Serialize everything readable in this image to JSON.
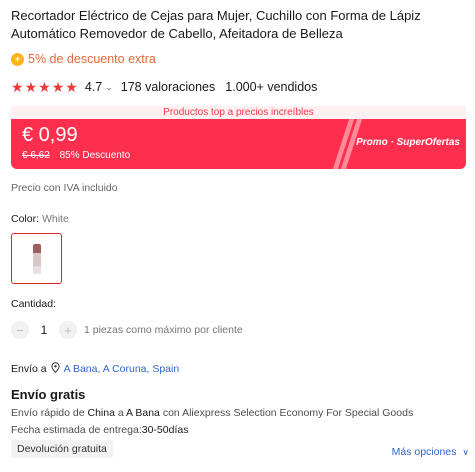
{
  "product": {
    "title": "Recortador Eléctrico de Cejas para Mujer, Cuchillo con Forma de Lápiz Automático Removedor de Cabello, Afeitadora de Belleza",
    "extra_discount": "5% de descuento extra",
    "rating": "4.7",
    "reviews": "178 valoraciones",
    "sold": "1.000+ vendidos"
  },
  "promo": {
    "strip_text": "Productos top a precios increíbles",
    "price": "€ 0,99",
    "original_price": "€ 6,62",
    "discount": "85% Descuento",
    "label": "Promo · SuperOfertas"
  },
  "tax_note": "Precio con IVA incluido",
  "color": {
    "label": "Color:",
    "value": "White"
  },
  "quantity": {
    "label": "Cantidad:",
    "value": "1",
    "minus": "−",
    "plus": "+",
    "note": "1 piezas como máximo por cliente"
  },
  "shipping": {
    "to_label": "Envío a",
    "location": "A Bana, A Coruna, Spain",
    "free_title": "Envío gratis",
    "desc_prefix": "Envío rápido de",
    "origin": "China",
    "desc_mid": "a",
    "destination": "A Bana",
    "desc_suffix": "con Aliexpress Selection Economy For Special Goods",
    "date_label": "Fecha estimada de entrega:",
    "date_value": "30-50días"
  },
  "returns": {
    "badge": "Devolución gratuita"
  },
  "more_options": "Más opciones",
  "colors": {
    "accent": "#fe2f4e",
    "link": "#2e67c9",
    "star": "#ea3a3a",
    "extra": "#e5683b"
  },
  "icons": [
    "coin-icon",
    "star-icon",
    "chevron-down-icon",
    "location-pin-icon"
  ]
}
